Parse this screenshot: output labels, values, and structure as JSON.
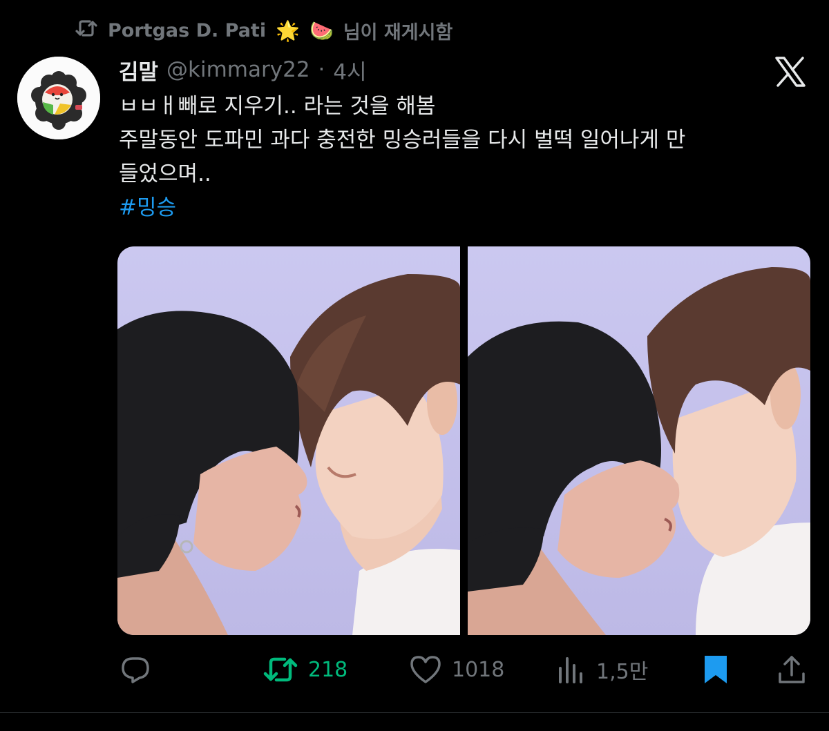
{
  "repost_header": {
    "icon": "repost-icon",
    "reposter_name": "Portgas D. Pati",
    "emoji_1": "🌟",
    "emoji_2": "🍉",
    "suffix": "님이 재게시함"
  },
  "tweet": {
    "author_name": "김말",
    "handle": "@kimmary22",
    "dot": "·",
    "time": "4시",
    "platform_icon": "x-logo-icon",
    "lines": [
      "ㅂㅂㅐ빼로 지우기.. 라는 것을 해봄",
      "주말동안 도파민 과다 충전한 밍승러들을 다시 벌떡 일어나게 만",
      "들었으며.."
    ],
    "hashtag": "#밍승"
  },
  "colors": {
    "background": "#000000",
    "text": "#e7e9ea",
    "muted": "#71767b",
    "link": "#1d9bf0",
    "repost_green": "#00ba7c",
    "bookmark_blue": "#1d9bf0",
    "photo_backdrop": "#c9c6ee"
  },
  "actions": {
    "reply": {
      "icon": "reply-icon",
      "count": ""
    },
    "repost": {
      "icon": "repost-icon",
      "count": "218"
    },
    "like": {
      "icon": "heart-icon",
      "count": "1018"
    },
    "views": {
      "icon": "views-chart-icon",
      "count": "1,5만"
    },
    "bookmark": {
      "icon": "bookmark-filled-icon"
    },
    "share": {
      "icon": "share-icon"
    }
  }
}
